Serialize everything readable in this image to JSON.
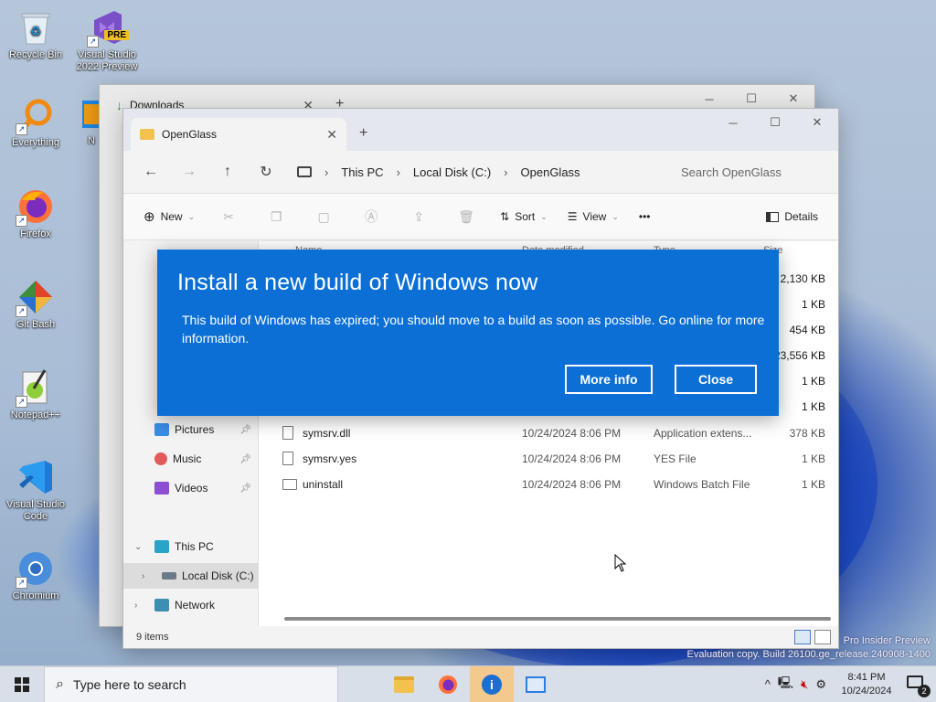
{
  "desktop": {
    "icons": [
      {
        "label": "Recycle Bin",
        "icon": "recycle-bin-icon"
      },
      {
        "label": "Visual Studio 2022 Preview",
        "badge": "PRE",
        "icon": "visual-studio-icon"
      },
      {
        "label": "Everything",
        "icon": "everything-search-icon"
      },
      {
        "label": "Firefox",
        "icon": "firefox-icon"
      },
      {
        "label": "Git Bash",
        "icon": "git-bash-icon"
      },
      {
        "label": "Notepad++",
        "icon": "notepad-plus-plus-icon"
      },
      {
        "label": "Visual Studio Code",
        "icon": "vscode-icon"
      },
      {
        "label": "Chromium",
        "icon": "chromium-icon"
      }
    ],
    "partial_label": "N"
  },
  "back_window": {
    "tab_title": "Downloads"
  },
  "explorer": {
    "tab_title": "OpenGlass",
    "breadcrumb": [
      "This PC",
      "Local Disk (C:)",
      "OpenGlass"
    ],
    "search_placeholder": "Search OpenGlass",
    "commands": {
      "new": "New",
      "sort": "Sort",
      "view": "View",
      "more": "•••",
      "details": "Details"
    },
    "columns": {
      "name": "Name",
      "date": "Date modified",
      "type": "Type",
      "size": "Size"
    },
    "visible_sizes": [
      "2,130 KB",
      "1 KB",
      "454 KB",
      "23,556 KB",
      "1 KB",
      "1 KB"
    ],
    "files": [
      {
        "name": "symsrv.dll",
        "date": "10/24/2024 8:06 PM",
        "type": "Application extens...",
        "size": "378 KB"
      },
      {
        "name": "symsrv.yes",
        "date": "10/24/2024 8:06 PM",
        "type": "YES File",
        "size": "1 KB"
      },
      {
        "name": "uninstall",
        "date": "10/24/2024 8:06 PM",
        "type": "Windows Batch File",
        "size": "1 KB"
      }
    ],
    "nav": {
      "pictures": "Pictures",
      "music": "Music",
      "videos": "Videos",
      "this_pc": "This PC",
      "local_disk": "Local Disk (C:)",
      "network": "Network"
    },
    "status": "9 items"
  },
  "dialog": {
    "title": "Install a new build of Windows now",
    "message": "This build of Windows has expired; you should move to a build as soon as possible. Go online for more information.",
    "more_info": "More info",
    "close": "Close"
  },
  "watermark": {
    "line1": "Pro Insider Preview",
    "line2": "Evaluation copy. Build 26100.ge_release.240908-1400"
  },
  "taskbar": {
    "search_placeholder": "Type here to search",
    "time": "8:41 PM",
    "date": "10/24/2024",
    "notification_count": "2"
  },
  "colors": {
    "dialog_blue": "#0b6fd6",
    "taskbar_bg": "#d9dfe8",
    "active_app": "#f3c98e"
  }
}
